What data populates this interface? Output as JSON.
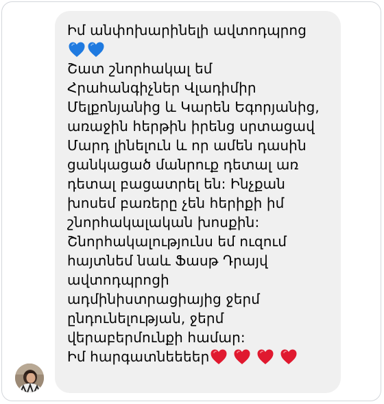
{
  "message": {
    "lines": [
      "Իմ անփոխարինելի ավտոդպրոց",
      "",
      "Շատ շնորհակալ եմ",
      "Հրահանգիչներ Վլադիմիր",
      "Մելքոնյանից և Կարեն Եգորյանից,",
      "առաջին հերթին իրենց սրտացավ",
      "Մարդ լինելուն և որ ամեն դասին",
      "ցանկացած մանրուք դետալ առ",
      "դետալ բացատրել են: Ինչքան",
      "խոսեմ բառերը չեն հերիքի իմ",
      "շնորհակալական խոսքին:",
      "Շնորհակալությունս եմ ուզում",
      "հայտնեմ նաև Ֆասթ Դրայվ",
      "ավտոդպրոցի",
      "ադմինիստրացիայից ջերմ",
      "ընդունելության, ջերմ",
      "վերաբերմունքի համար:",
      "Իմ հարգատնեեեեր"
    ],
    "blue_hearts": [
      "blue-heart",
      "blue-heart"
    ],
    "red_hearts": [
      "red-heart",
      "red-heart",
      "red-heart",
      "red-heart"
    ],
    "colors": {
      "bubble_bg": "#f0f0f0",
      "text": "#050505",
      "blue_heart": "#1f7ae0",
      "red_heart": "#e0192f"
    }
  }
}
